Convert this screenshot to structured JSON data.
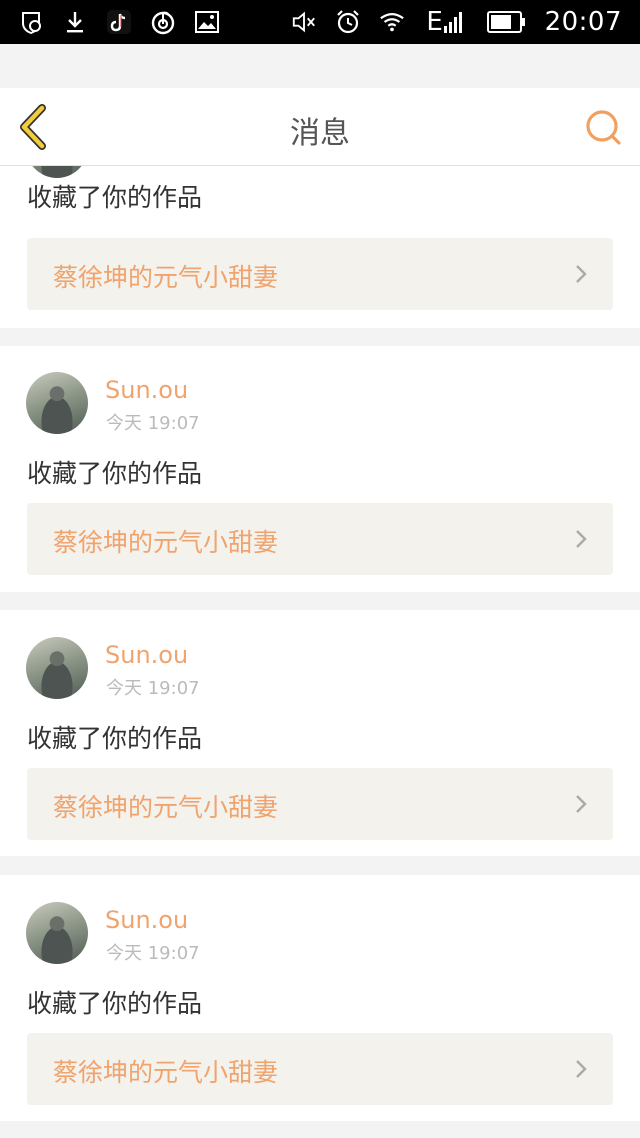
{
  "status_bar": {
    "time": "20:07",
    "left_icons": [
      "notification-shield-icon",
      "download-icon",
      "tiktok-icon",
      "netease-music-icon",
      "image-icon"
    ],
    "right_icons": [
      "mute-icon",
      "alarm-icon",
      "wifi-icon",
      "signal-e-icon",
      "battery-icon"
    ],
    "network_letter": "E"
  },
  "nav": {
    "title": "消息",
    "back_icon": "back-chevron-icon",
    "search_icon": "search-icon"
  },
  "colors": {
    "accent": "#f0a36d",
    "back_yellow": "#f2cc3b",
    "search_orange": "#f2a05f",
    "card_bg": "#ffffff",
    "link_bg": "#f3f2ed",
    "page_bg": "#f3f3f3"
  },
  "messages": [
    {
      "partial": true,
      "action": "收藏了你的作品",
      "work": "蔡徐坤的元气小甜妻"
    },
    {
      "username": "Sun.ou",
      "time": "今天 19:07",
      "action": "收藏了你的作品",
      "work": "蔡徐坤的元气小甜妻"
    },
    {
      "username": "Sun.ou",
      "time": "今天 19:07",
      "action": "收藏了你的作品",
      "work": "蔡徐坤的元气小甜妻"
    },
    {
      "username": "Sun.ou",
      "time": "今天 19:07",
      "action": "收藏了你的作品",
      "work": "蔡徐坤的元气小甜妻"
    }
  ]
}
